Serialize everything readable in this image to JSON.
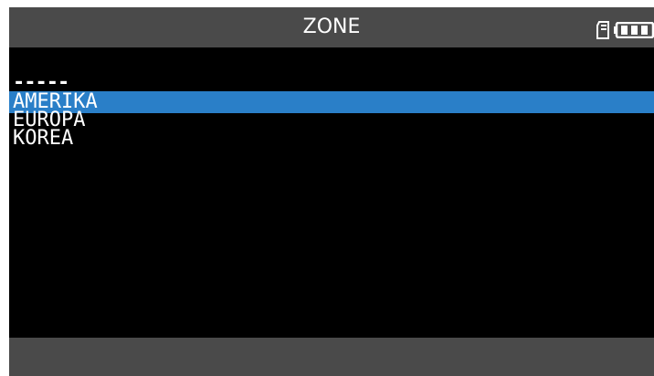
{
  "header": {
    "title": "ZONE",
    "icons": [
      "sd-card-icon",
      "battery-icon"
    ],
    "battery_level": 1.0
  },
  "menu": {
    "separator": "-----",
    "items": [
      {
        "label": "AMERIKA",
        "selected": true
      },
      {
        "label": "EUROPA",
        "selected": false
      },
      {
        "label": "KOREA",
        "selected": false
      }
    ]
  },
  "colors": {
    "screen_background": "#000000",
    "bar_background": "#4a4a4a",
    "selection_highlight": "#2a7fc8",
    "text": "#ffffff"
  }
}
